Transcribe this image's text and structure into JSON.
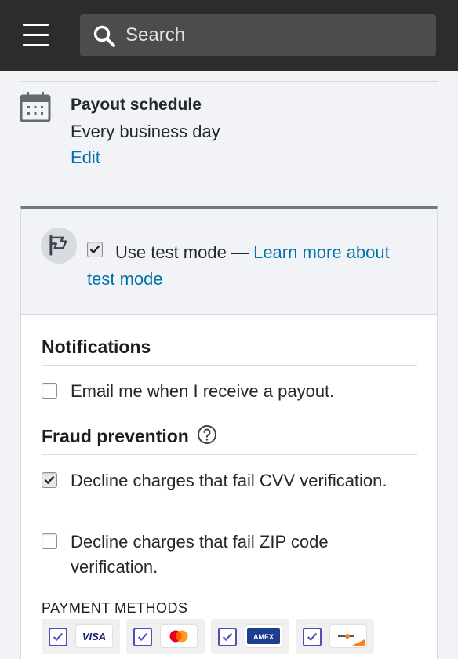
{
  "header": {
    "menu_icon": "hamburger-menu-icon",
    "search": {
      "placeholder": "Search",
      "icon": "search-icon"
    }
  },
  "payout": {
    "icon": "calendar-icon",
    "title": "Payout schedule",
    "value": "Every business day",
    "edit_label": "Edit"
  },
  "test_mode": {
    "icon": "flag-icon",
    "checked": true,
    "label": "Use test mode — ",
    "link_text": "Learn more about test mode"
  },
  "notifications": {
    "title": "Notifications",
    "options": [
      {
        "label": "Email me when I receive a payout.",
        "checked": false
      }
    ]
  },
  "fraud": {
    "title": "Fraud prevention",
    "help_icon": "help-circle-icon",
    "options": [
      {
        "label": "Decline charges that fail CVV verification.",
        "checked": true
      },
      {
        "label": "Decline charges that fail ZIP code verification.",
        "checked": false
      }
    ]
  },
  "payment_methods": {
    "title": "PAYMENT METHODS",
    "items": [
      {
        "name": "VISA",
        "icon": "visa-card-icon",
        "checked": true
      },
      {
        "name": "Mastercard",
        "icon": "mastercard-icon",
        "checked": true
      },
      {
        "name": "AMEX",
        "icon": "amex-card-icon",
        "checked": true
      },
      {
        "name": "Discover",
        "icon": "discover-card-icon",
        "checked": true
      }
    ]
  },
  "colors": {
    "topbar": "#2c2c2c",
    "link": "#0073aa",
    "checkbox_accent": "#4f4fb9"
  }
}
